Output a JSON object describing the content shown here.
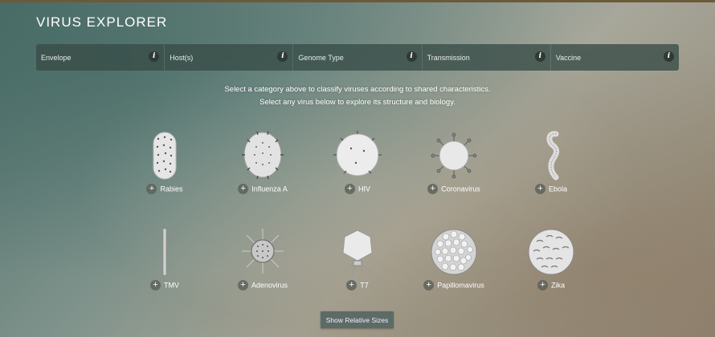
{
  "app": {
    "title": "VIRUS EXPLORER"
  },
  "filters": [
    {
      "label": "Envelope",
      "icon": "info-icon"
    },
    {
      "label": "Host(s)",
      "icon": "info-icon"
    },
    {
      "label": "Genome Type",
      "icon": "info-icon"
    },
    {
      "label": "Transmission",
      "icon": "info-icon"
    },
    {
      "label": "Vaccine",
      "icon": "info-icon"
    }
  ],
  "info_glyph": "i",
  "plus_glyph": "+",
  "instructions": {
    "line1": "Select a category above to classify viruses according to shared characteristics.",
    "line2": "Select any virus below to explore its structure and biology."
  },
  "viruses": [
    {
      "name": "Rabies",
      "icon": "rabies-virus-icon"
    },
    {
      "name": "Influenza A",
      "icon": "influenza-virus-icon"
    },
    {
      "name": "HIV",
      "icon": "hiv-virus-icon"
    },
    {
      "name": "Coronavirus",
      "icon": "coronavirus-icon"
    },
    {
      "name": "Ebola",
      "icon": "ebola-virus-icon"
    },
    {
      "name": "TMV",
      "icon": "tmv-virus-icon"
    },
    {
      "name": "Adenovirus",
      "icon": "adenovirus-icon"
    },
    {
      "name": "T7",
      "icon": "t7-phage-icon"
    },
    {
      "name": "Papillomavirus",
      "icon": "papillomavirus-icon"
    },
    {
      "name": "Zika",
      "icon": "zika-virus-icon"
    }
  ],
  "show_sizes_button": "Show Relative Sizes"
}
